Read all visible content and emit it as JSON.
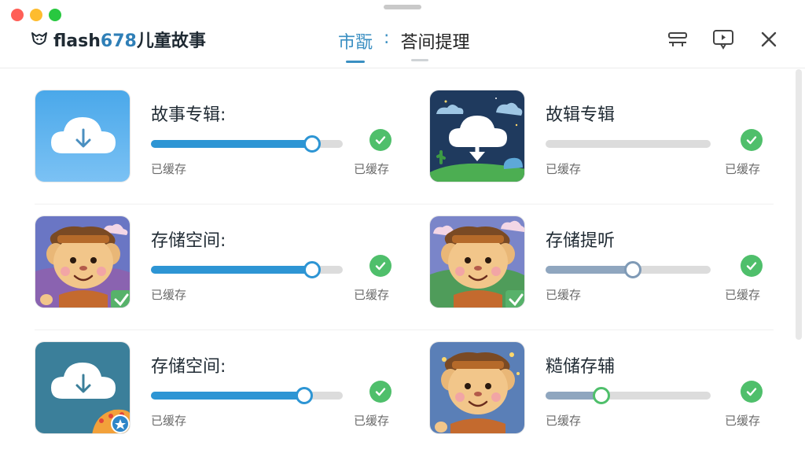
{
  "app": {
    "brand_part1": "flash",
    "brand_part2": "678",
    "brand_part3": "儿童故事"
  },
  "tabs": {
    "active": "市翫",
    "separator": ":",
    "inactive": "荅间提理"
  },
  "header_icons": [
    "list-toggle-icon",
    "feedback-icon",
    "close-icon"
  ],
  "items": [
    {
      "title": "故事专辑:",
      "status_left": "已缓存",
      "status_right": "已缓存",
      "progress": 0.84,
      "slider_style": "blue",
      "thumb": "cloud-download"
    },
    {
      "title": "故辑专辑",
      "status_left": "已缓存",
      "status_right": "已缓存",
      "progress": 0.0,
      "slider_style": "none",
      "thumb": "cloud-night"
    },
    {
      "title": "存储空间:",
      "status_left": "已缓存",
      "status_right": "已缓存",
      "progress": 0.84,
      "slider_style": "blue",
      "thumb": "monkey-check"
    },
    {
      "title": "存储提听",
      "status_left": "已缓存",
      "status_right": "已缓存",
      "progress": 0.53,
      "slider_style": "gray",
      "thumb": "monkey-check"
    },
    {
      "title": "存储空间:",
      "status_left": "已缓存",
      "status_right": "已缓存",
      "progress": 0.8,
      "slider_style": "blue",
      "thumb": "cloud-teal"
    },
    {
      "title": "糙储存辅",
      "status_left": "已缓存",
      "status_right": "已缓存",
      "progress": 0.34,
      "slider_style": "green",
      "thumb": "monkey"
    }
  ],
  "colors": {
    "accent": "#2d95d4",
    "tab_active": "#3a8fc2",
    "check_green": "#4fbf6b"
  }
}
